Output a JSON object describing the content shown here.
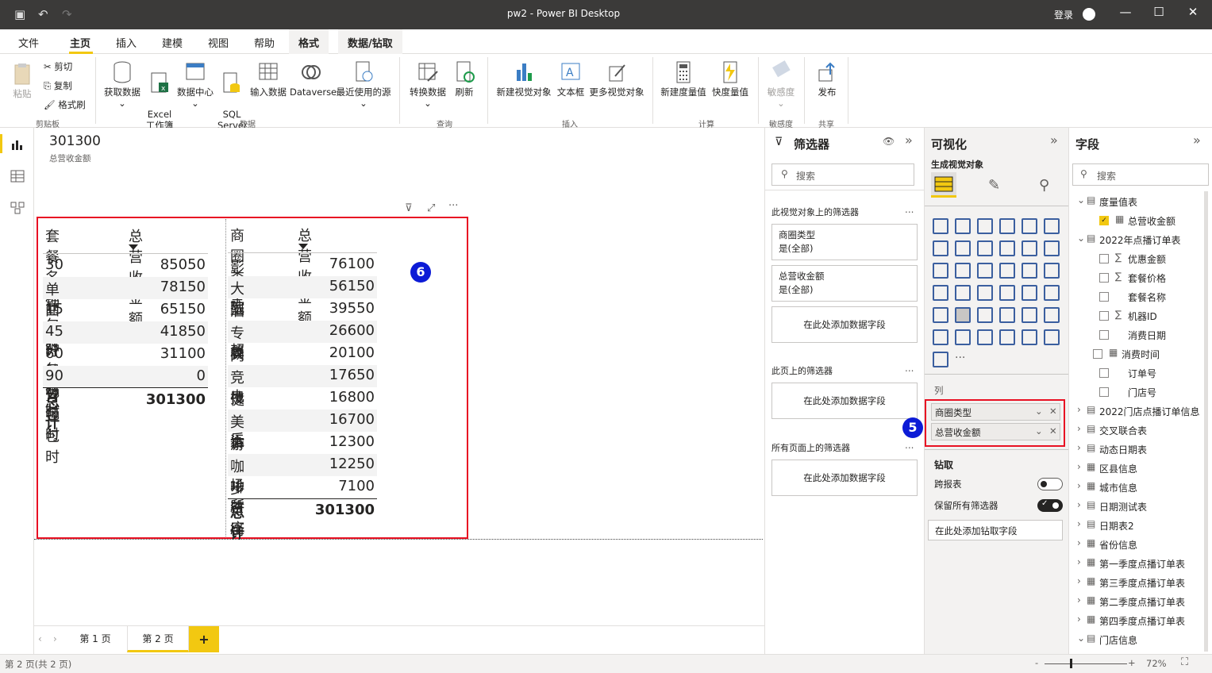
{
  "window": {
    "title": "pw2 - Power BI Desktop",
    "login": "登录"
  },
  "tabs": [
    "文件",
    "主页",
    "插入",
    "建模",
    "视图",
    "帮助",
    "格式",
    "数据/钻取"
  ],
  "ribbon": {
    "paste": "粘贴",
    "cut": "剪切",
    "copy": "复制",
    "format_painter": "格式刷",
    "get_data": "获取数据",
    "excel": "Excel\n工作簿",
    "data_center": "数据中心",
    "sql": "SQL\nServer",
    "enter_data": "输入数据",
    "dataverse": "Dataverse",
    "recent_sources": "最近使用的源",
    "transform": "转换数据",
    "refresh": "刷新",
    "new_visual": "新建视觉对象",
    "text_box": "文本框",
    "more_visuals": "更多视觉对象",
    "new_measure": "新建度量值",
    "quick_measure": "快度量值",
    "sensitivity": "敏感度",
    "publish": "发布",
    "groups": [
      "剪贴板",
      "数据",
      "查询",
      "插入",
      "计算",
      "敏感度",
      "共享"
    ]
  },
  "card": {
    "value": "301300",
    "label": "总营收金额"
  },
  "table1": {
    "headers": [
      "套餐名称",
      "总营收金额"
    ],
    "rows": [
      [
        "30分钟包时",
        "85050"
      ],
      [
        "单曲",
        "78150"
      ],
      [
        "15分钟包时",
        "65150"
      ],
      [
        "45分钟包时",
        "41850"
      ],
      [
        "60分钟包时",
        "31100"
      ],
      [
        "90分钟包时",
        "0"
      ]
    ],
    "total": [
      "总计",
      "301300"
    ]
  },
  "table2": {
    "headers": [
      "商圈类型",
      "总营收金额"
    ],
    "rows": [
      [
        "影剧院",
        "76100"
      ],
      [
        "大型商超",
        "56150"
      ],
      [
        "酒店餐厅",
        "39550"
      ],
      [
        "专卖店",
        "26600"
      ],
      [
        "网吧电竞",
        "20100"
      ],
      [
        "竞技娱乐",
        "17650"
      ],
      [
        "健身运动",
        "16800"
      ],
      [
        "美食街",
        "16700"
      ],
      [
        "游艺场所",
        "12300"
      ],
      [
        "咖啡茶座",
        "12250"
      ],
      [
        "步行街",
        "7100"
      ]
    ],
    "total": [
      "总计",
      "301300"
    ]
  },
  "badges": {
    "six": "6",
    "five": "5"
  },
  "pages": {
    "p1": "第 1 页",
    "p2": "第 2 页",
    "add": "+"
  },
  "status": {
    "page_info": "第 2 页(共 2 页)",
    "zoom": "72%"
  },
  "filters": {
    "title": "筛选器",
    "search": "搜索",
    "on_visual": "此视觉对象上的筛选器",
    "card1_name": "商圈类型",
    "card1_val": "是(全部)",
    "card2_name": "总营收金额",
    "card2_val": "是(全部)",
    "add_here": "在此处添加数据字段",
    "on_page": "此页上的筛选器",
    "on_all": "所有页面上的筛选器",
    "dots": "..."
  },
  "viz": {
    "title": "可视化",
    "subtitle": "生成视觉对象",
    "columns_label": "列",
    "well1": "商圈类型",
    "well2": "总营收金额",
    "drill": "钻取",
    "cross_report": "跨报表",
    "keep_filters": "保留所有筛选器",
    "add_drill": "在此处添加钻取字段",
    "more": "···"
  },
  "fields": {
    "title": "字段",
    "search": "搜索",
    "items": [
      "度量值表",
      "总营收金额",
      "2022年点播订单表",
      "优惠金额",
      "套餐价格",
      "套餐名称",
      "机器ID",
      "消费日期",
      "消费时间",
      "订单号",
      "门店号",
      "2022门店点播订单信息",
      "交叉联合表",
      "动态日期表",
      "区县信息",
      "城市信息",
      "日期测试表",
      "日期表2",
      "省份信息",
      "第一季度点播订单表",
      "第三季度点播订单表",
      "第二季度点播订单表",
      "第四季度点播订单表",
      "门店信息"
    ]
  },
  "colors": {
    "accent": "#f2c811",
    "red": "#e81123",
    "badge": "#0c1bd6"
  }
}
